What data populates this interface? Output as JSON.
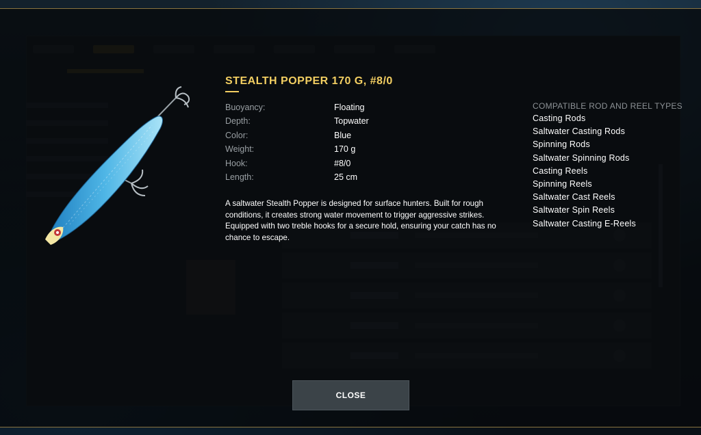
{
  "item": {
    "title": "STEALTH POPPER 170 G, #8/0",
    "image_icon": "popper-lure-icon",
    "colors": {
      "accent": "#f3cf62",
      "lure_body": "#4fb6e6",
      "lure_belly": "#a9e3f7"
    }
  },
  "stats": [
    {
      "label": "Buoyancy:",
      "value": "Floating"
    },
    {
      "label": "Depth:",
      "value": "Topwater"
    },
    {
      "label": "Color:",
      "value": "Blue"
    },
    {
      "label": "Weight:",
      "value": "170 g"
    },
    {
      "label": "Hook:",
      "value": "#8/0"
    },
    {
      "label": "Length:",
      "value": "25 cm"
    }
  ],
  "description": "A saltwater Stealth Popper is designed for surface hunters. Built for rough conditions, it creates strong water movement to trigger aggressive strikes. Equipped with two treble hooks for a secure hold, ensuring your catch has no chance to escape.",
  "compatible": {
    "title": "COMPATIBLE ROD AND REEL TYPES",
    "items": [
      "Casting Rods",
      "Saltwater Casting Rods",
      "Spinning Rods",
      "Saltwater Spinning Rods",
      "Casting Reels",
      "Spinning Reels",
      "Saltwater Cast Reels",
      "Saltwater Spin Reels",
      "Saltwater Casting E-Reels"
    ]
  },
  "close_label": "CLOSE"
}
